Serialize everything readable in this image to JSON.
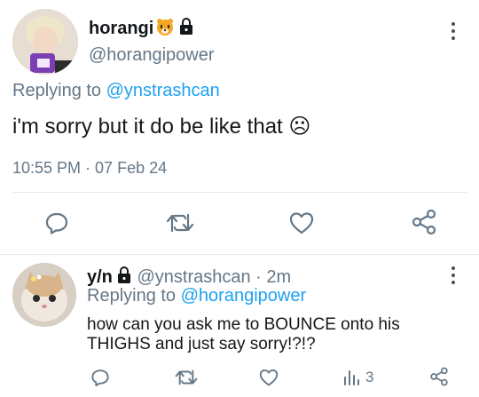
{
  "main_tweet": {
    "display_name": "horangi",
    "handle": "@horangipower",
    "replying_prefix": "Replying to ",
    "replying_to": "@ynstrashcan",
    "text": "i'm sorry but it do be like that ☹",
    "time": "10:55 PM",
    "separator": " · ",
    "date": "07 Feb 24"
  },
  "reply_tweet": {
    "display_name": "y/n",
    "handle": "@ynstrashcan",
    "separator": " · ",
    "age": "2m",
    "replying_prefix": "Replying to ",
    "replying_to": "@horangipower",
    "text_line1": "how can you ask me to BOUNCE onto his",
    "text_line2": "THIGHS and just say sorry!?!?",
    "views": "3"
  },
  "icons": {
    "reply": "reply-icon",
    "retweet": "retweet-icon",
    "like": "heart-icon",
    "share": "share-icon",
    "views": "views-icon",
    "more": "more-icon",
    "lock": "lock-icon",
    "tiger": "tiger-emoji-icon"
  },
  "colors": {
    "text": "#14171a",
    "secondary": "#657786",
    "link": "#1da1f2",
    "divider": "#e1e8ed",
    "icon": "#657786"
  }
}
